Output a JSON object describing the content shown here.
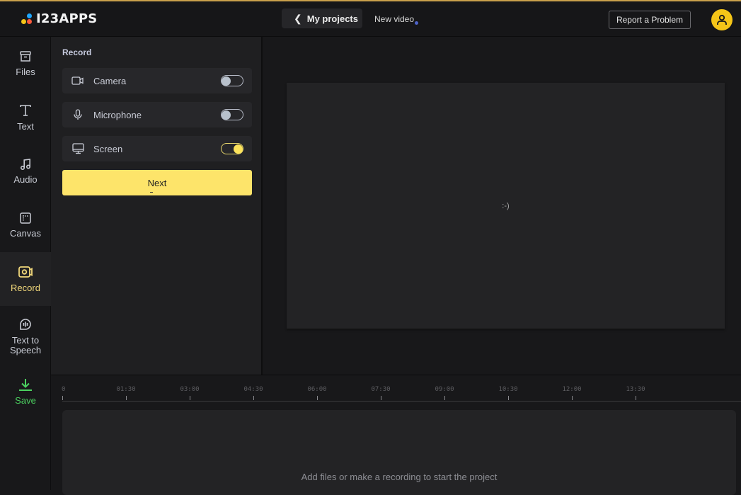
{
  "brand": {
    "name": "I23APPS",
    "dot_colors": [
      "#1ea7ff",
      "#f5c518",
      "#ff5a3c"
    ]
  },
  "header": {
    "back_label": "My projects",
    "project_name": "New video",
    "report_label": "Report a Problem",
    "accent_color": "#c9a04b",
    "avatar_color": "#f5c518"
  },
  "sidebar": {
    "items": [
      {
        "label": "Files",
        "icon": "archive-icon"
      },
      {
        "label": "Text",
        "icon": "text-icon"
      },
      {
        "label": "Audio",
        "icon": "music-note-icon"
      },
      {
        "label": "Canvas",
        "icon": "canvas-icon"
      },
      {
        "label": "Record",
        "icon": "record-camera-icon",
        "active": true
      },
      {
        "label": "Text to Speech",
        "icon": "speech-icon"
      },
      {
        "label": "Save",
        "icon": "download-icon"
      }
    ]
  },
  "record_panel": {
    "title": "Record",
    "options": [
      {
        "label": "Camera",
        "icon": "camera-icon",
        "enabled": false
      },
      {
        "label": "Microphone",
        "icon": "microphone-icon",
        "enabled": false
      },
      {
        "label": "Screen",
        "icon": "monitor-icon",
        "enabled": true
      }
    ],
    "next_label": "Next"
  },
  "preview": {
    "placeholder": ":-)"
  },
  "timeline": {
    "ticks": [
      "0",
      "01:30",
      "03:00",
      "04:30",
      "06:00",
      "07:30",
      "09:00",
      "10:30",
      "12:00",
      "13:30"
    ],
    "empty_message": "Add files or make a recording to start the project"
  }
}
